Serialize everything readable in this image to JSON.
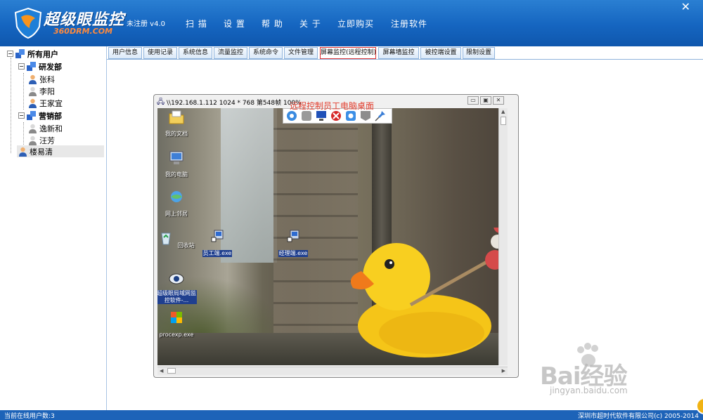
{
  "header": {
    "app_title": "超级眼监控",
    "app_sub": "360DRM.COM",
    "reg_status": "未注册 v4.0",
    "menu": [
      {
        "label": "扫 描"
      },
      {
        "label": "设 置"
      },
      {
        "label": "帮 助"
      },
      {
        "label": "关 于"
      },
      {
        "label": "立即购买"
      },
      {
        "label": "注册软件"
      }
    ],
    "close_glyph": "✕"
  },
  "tree": {
    "root": "所有用户",
    "groups": [
      {
        "name": "研发部",
        "users": [
          "张科",
          "李阳",
          "王家宜"
        ]
      },
      {
        "name": "营销部",
        "users": [
          "逸新和",
          "汪芳"
        ]
      }
    ],
    "ungrouped": [
      "楼易清"
    ]
  },
  "tabs": [
    {
      "label": "用户信息"
    },
    {
      "label": "使用记录"
    },
    {
      "label": "系统信息"
    },
    {
      "label": "流量监控"
    },
    {
      "label": "系统命令"
    },
    {
      "label": "文件管理"
    },
    {
      "label": "屏幕监控(远程控制)"
    },
    {
      "label": "屏幕墙监控"
    },
    {
      "label": "被控端设置"
    },
    {
      "label": "限制设置"
    }
  ],
  "active_tab_index": 6,
  "remote_window": {
    "title": "\\\\192.168.1.112 1024 * 768 第548帧 100%",
    "caption": "远程控制员工电脑桌面",
    "controls": {
      "minimize": "▭",
      "restore": "▣",
      "close": "✕"
    },
    "toolbar_icons": [
      "settings-gear-icon",
      "blank-icon",
      "monitor-icon",
      "stop-icon",
      "config-icon",
      "blank-icon",
      "pin-icon"
    ]
  },
  "desktop_icons": [
    {
      "label": "我的文档",
      "icon": "folder-icon",
      "selected": false
    },
    {
      "label": "我的电脑",
      "icon": "computer-icon",
      "selected": false
    },
    {
      "label": "网上邻居",
      "icon": "network-icon",
      "selected": false
    },
    {
      "label": "回收站",
      "icon": "recycle-bin-icon",
      "selected": false
    },
    {
      "label": "超级眼局域网监控软件-...",
      "icon": "shortcut-icon",
      "selected": true
    },
    {
      "label": "procexp.exe",
      "icon": "procexp-icon",
      "selected": false
    },
    {
      "label": "员工端.exe",
      "icon": "exe-icon",
      "selected": true
    },
    {
      "label": "经理端.exe",
      "icon": "exe-icon",
      "selected": true
    }
  ],
  "status": {
    "left": "当前在线用户数:3",
    "right": "深圳市超时代软件有限公司(c) 2005-2014"
  },
  "watermark": {
    "brand": "Bai经验",
    "url": "jingyan.baidu.com"
  },
  "colors": {
    "header_blue": "#1565c0",
    "accent_red": "#e03030",
    "caption_red": "#e23c2c",
    "status_blue": "#1d63b8"
  }
}
